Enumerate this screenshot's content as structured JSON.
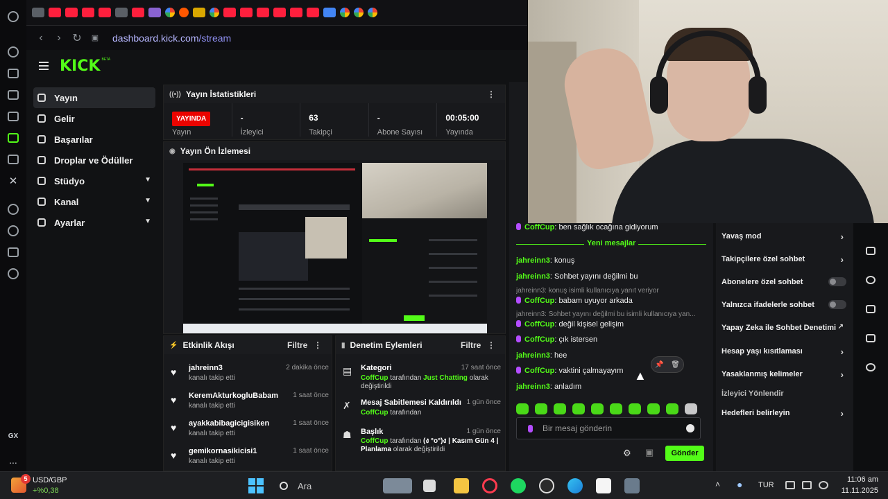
{
  "browser": {
    "url_host": "dashboard.kick.com",
    "url_path": "/stream",
    "gx_label": "GX",
    "more_label": "..."
  },
  "brand": {
    "logo": "KICK",
    "beta": "BETA",
    "accent": "#53fc18"
  },
  "sidenav": {
    "items": [
      {
        "label": "Yayın"
      },
      {
        "label": "Gelir"
      },
      {
        "label": "Başarılar"
      },
      {
        "label": "Droplar ve Ödüller"
      },
      {
        "label": "Stüdyo"
      },
      {
        "label": "Kanal"
      },
      {
        "label": "Ayarlar"
      }
    ]
  },
  "stats": {
    "title": "Yayın İstatistikleri",
    "live_badge": "YAYINDA",
    "status_label": "Yayın",
    "viewers_value": "-",
    "viewers_label": "İzleyici",
    "followers_value": "63",
    "followers_label": "Takipçi",
    "subs_value": "-",
    "subs_label": "Abone Sayısı",
    "uptime_value": "00:05:00",
    "uptime_label": "Yayında"
  },
  "preview": {
    "title": "Yayın Ön İzlemesi"
  },
  "activity": {
    "title": "Etkinlik Akışı",
    "filter": "Filtre",
    "items": [
      {
        "name": "jahreinn3",
        "sub": "kanalı takip etti",
        "time": "2 dakika önce"
      },
      {
        "name": "KeremAkturkogluBabam",
        "sub": "kanalı takip etti",
        "time": "1 saat önce"
      },
      {
        "name": "ayakkabibagicigisiken",
        "sub": "kanalı takip etti",
        "time": "1 saat önce"
      },
      {
        "name": "gemikornasikicisi1",
        "sub": "kanalı takip etti",
        "time": "1 saat önce"
      }
    ]
  },
  "moderation": {
    "title": "Denetim Eylemleri",
    "filter": "Filtre",
    "items": [
      {
        "title": "Kategori",
        "time": "17 saat önce",
        "user": "CoffCup",
        "pre": " tarafından ",
        "value": "Just Chatting",
        "post": " olarak değiştirildi"
      },
      {
        "title": "Mesaj Sabitlemesi Kaldırıldı",
        "time": "1 gün önce",
        "user": "CoffCup",
        "pre": " tarafından",
        "value": "",
        "post": ""
      },
      {
        "title": "Başlık",
        "time": "1 gün önce",
        "user": "CoffCup",
        "pre": " tarafından ",
        "value": "(ง °o°)ง | Kasım Gün 4 | Planlama",
        "post": " olarak değiştirildi"
      }
    ]
  },
  "chat": {
    "pinned_user": "CoffCup",
    "pinned_text": ": ben sağlık ocağına gidiyorum",
    "new_messages": "Yeni mesajlar",
    "messages": [
      {
        "user": "jahreinn3",
        "text": ": konuş"
      },
      {
        "user": "jahreinn3",
        "text": ": Sohbet yayını değilmi bu"
      },
      {
        "reply": "jahreinn3: konuş isimli kullanıcıya yanıt veriyor"
      },
      {
        "user": "CoffCup",
        "text": ": babam uyuyor arkada",
        "pin": true
      },
      {
        "reply": "jahreinn3: Sohbet yayını değilmi bu isimli kullanıcıya yan..."
      },
      {
        "user": "CoffCup",
        "text": ": değil kişisel gelişim",
        "pin": true
      },
      {
        "user": "CoffCup",
        "text": ": çık istersen",
        "pin": true
      },
      {
        "user": "jahreinn3",
        "text": ": hee"
      },
      {
        "user": "CoffCup",
        "text": ": vaktini çalmayayım",
        "pin": true
      },
      {
        "user": "jahreinn3",
        "text": ": anladım"
      }
    ],
    "input_placeholder": "Bir mesaj gönderin",
    "send_label": "Gönder"
  },
  "chat_settings": {
    "items": [
      {
        "label": "Yavaş mod",
        "kind": "arrow"
      },
      {
        "label": "Takipçilere özel sohbet",
        "kind": "arrow"
      },
      {
        "label": "Abonelere özel sohbet",
        "kind": "toggle"
      },
      {
        "label": "Yalnızca ifadelerle sohbet",
        "kind": "toggle"
      },
      {
        "label": "Yapay Zeka ile Sohbet Denetimi",
        "kind": "external"
      },
      {
        "label": "Hesap yaşı kısıtlaması",
        "kind": "arrow"
      },
      {
        "label": "Yasaklanmış kelimeler",
        "kind": "arrow"
      },
      {
        "label": "İzleyici Yönlendir",
        "kind": "none"
      },
      {
        "label": "Hedefleri belirleyin",
        "kind": "arrow"
      }
    ]
  },
  "taskbar": {
    "weather_badge": "5",
    "stock_name": "USD/GBP",
    "stock_change": "+%0,38",
    "search_placeholder": "Ara",
    "language": "TUR",
    "time": "11:06 am",
    "date": "11.11.2025"
  }
}
